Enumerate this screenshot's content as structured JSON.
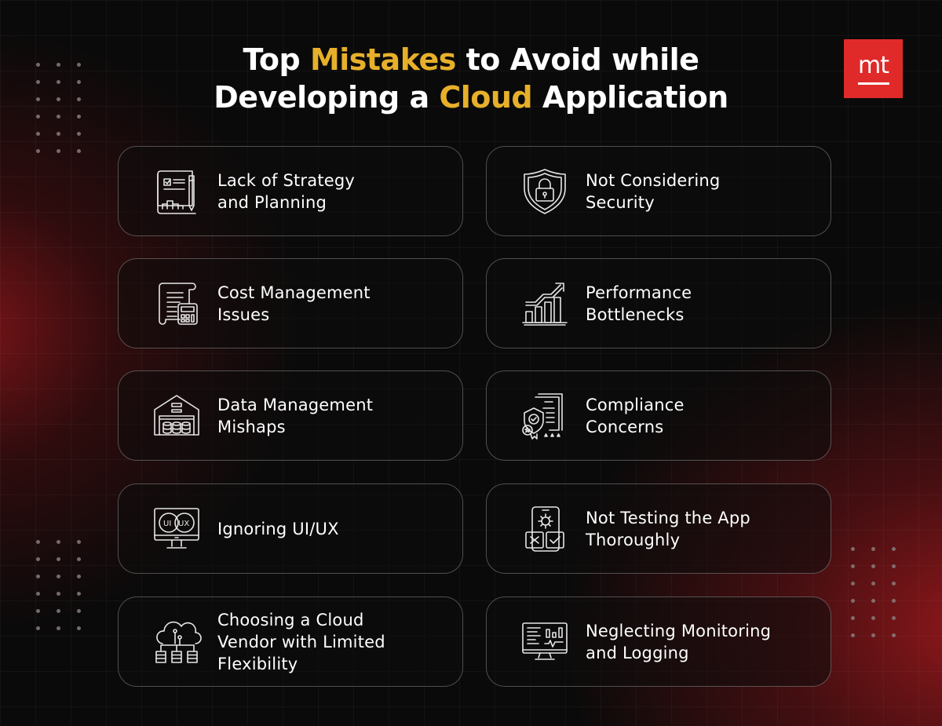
{
  "title": {
    "line1": {
      "pre": "Top ",
      "highlight": "Mistakes",
      "post": " to Avoid while"
    },
    "line2": {
      "pre": "Developing a ",
      "highlight": "Cloud",
      "post": " Application"
    }
  },
  "logo": {
    "text": "mt",
    "color": "#e02a2a"
  },
  "colors": {
    "highlight": "#e7b02a",
    "background": "#0b0a0a",
    "accent_red": "#8c161a"
  },
  "cards": [
    {
      "label": "Lack of Strategy\nand Planning",
      "icon": "blueprint-icon"
    },
    {
      "label": "Not Considering\nSecurity",
      "icon": "shield-lock-icon"
    },
    {
      "label": "Cost Management\nIssues",
      "icon": "invoice-calculator-icon"
    },
    {
      "label": "Performance\nBottlenecks",
      "icon": "growth-chart-icon"
    },
    {
      "label": "Data Management\nMishaps",
      "icon": "data-warehouse-icon"
    },
    {
      "label": "Compliance\nConcerns",
      "icon": "certificate-badge-icon"
    },
    {
      "label": "Ignoring UI/UX",
      "icon": "ui-ux-monitor-icon",
      "icon_text_ui": "UI",
      "icon_text_ux": "UX"
    },
    {
      "label": "Not Testing the App\nThoroughly",
      "icon": "mobile-testing-icon"
    },
    {
      "label": "Choosing a Cloud\nVendor with Limited\nFlexibility",
      "icon": "cloud-network-icon"
    },
    {
      "label": "Neglecting Monitoring\nand Logging",
      "icon": "monitoring-screen-icon"
    }
  ]
}
